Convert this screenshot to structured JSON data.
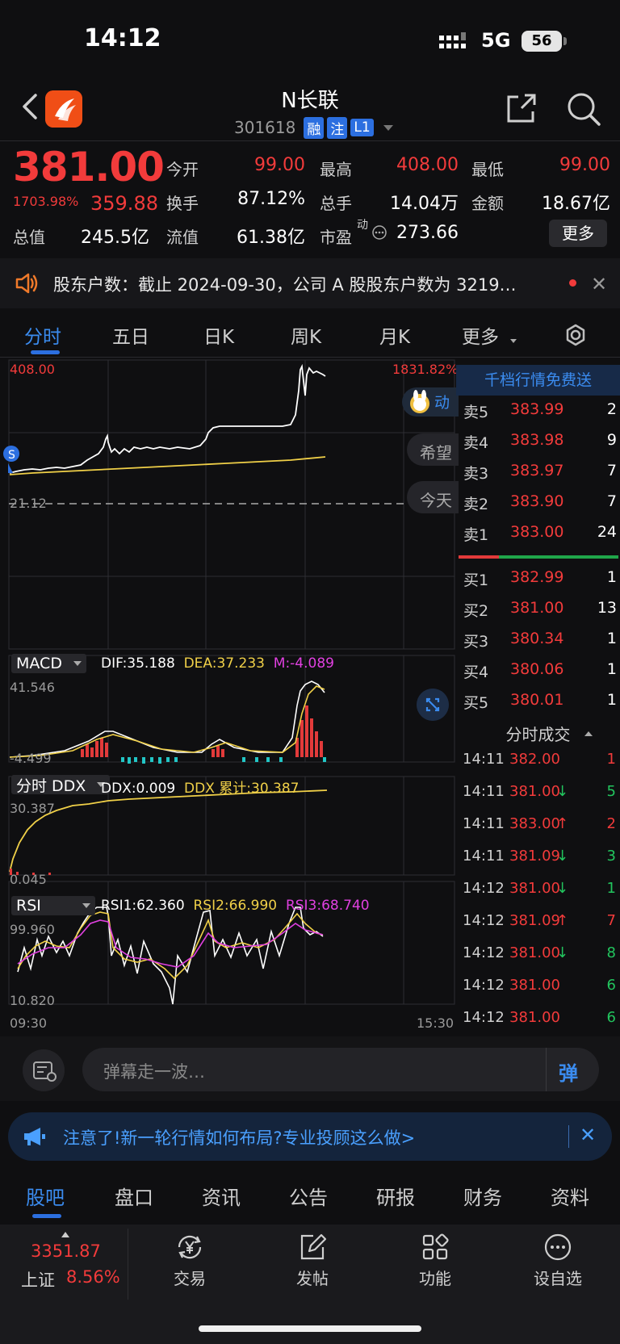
{
  "status": {
    "time": "14:12",
    "network": "5G",
    "battery": "56"
  },
  "header": {
    "stock_name": "N长联",
    "stock_code": "301618",
    "tags": [
      "融",
      "注",
      "L1"
    ]
  },
  "quote": {
    "price": "381.00",
    "change_pct": "1703.98%",
    "change": "359.88",
    "fields": [
      {
        "label": "今开",
        "value": "99.00",
        "color": "#f23b3b"
      },
      {
        "label": "最高",
        "value": "408.00",
        "color": "#f23b3b"
      },
      {
        "label": "最低",
        "value": "99.00",
        "color": "#f23b3b"
      },
      {
        "label": "换手",
        "value": "87.12%",
        "color": "#ffffff"
      },
      {
        "label": "总手",
        "value": "14.04万",
        "color": "#ffffff"
      },
      {
        "label": "金额",
        "value": "18.67亿",
        "color": "#ffffff"
      },
      {
        "label": "流值",
        "value": "61.38亿",
        "color": "#ffffff"
      },
      {
        "label": "市盈",
        "value": "273.66",
        "color": "#ffffff"
      }
    ],
    "total_cap_label": "总值",
    "total_cap_value": "245.5亿",
    "pe_superscript": "动",
    "more_label": "更多"
  },
  "notice": {
    "text": "股东户数：截止 2024-09-30，公司 A 股股东户数为 3219…",
    "close": "✕"
  },
  "chart_tabs": [
    "分时",
    "五日",
    "日K",
    "周K",
    "月K",
    "更多"
  ],
  "chart": {
    "high_label": "408.00",
    "high_pct": "1831.82%",
    "base_label": "21.12",
    "macd": {
      "selector": "MACD",
      "dif": "DIF:35.188",
      "dea": "DEA:37.233",
      "m": "M:-4.089",
      "max": "41.546",
      "min": "-4.499"
    },
    "ddx": {
      "selector": "分时 DDX",
      "ddx": "DDX:0.009",
      "ddx_cum": "DDX 累计:30.387",
      "max": "30.387",
      "min": "0.045"
    },
    "rsi": {
      "selector": "RSI",
      "rsi1": "RSI1:62.360",
      "rsi2": "RSI2:66.990",
      "rsi3": "RSI3:68.740",
      "max": "99.960",
      "min": "10.820"
    },
    "time_start": "09:30",
    "time_end": "15:30",
    "s_marker": "S",
    "chip_dong": "动",
    "chip_xiwang": "希望",
    "chip_jintian": "今天"
  },
  "orderbook": {
    "header": "千档行情免费送",
    "asks": [
      {
        "label": "卖5",
        "price": "383.99",
        "vol": "2"
      },
      {
        "label": "卖4",
        "price": "383.98",
        "vol": "9"
      },
      {
        "label": "卖3",
        "price": "383.97",
        "vol": "7"
      },
      {
        "label": "卖2",
        "price": "383.90",
        "vol": "7"
      },
      {
        "label": "卖1",
        "price": "383.00",
        "vol": "24"
      }
    ],
    "bids": [
      {
        "label": "买1",
        "price": "382.99",
        "vol": "1"
      },
      {
        "label": "买2",
        "price": "381.00",
        "vol": "13"
      },
      {
        "label": "买3",
        "price": "380.34",
        "vol": "1"
      },
      {
        "label": "买4",
        "price": "380.06",
        "vol": "1"
      },
      {
        "label": "买5",
        "price": "380.01",
        "vol": "1"
      }
    ],
    "trades_title": "分时成交",
    "trades": [
      {
        "time": "14:11",
        "price": "382.00",
        "arrow": "",
        "vol": "1",
        "vcolor": "#f23b3b"
      },
      {
        "time": "14:11",
        "price": "381.00",
        "arrow": "↓",
        "vol": "5",
        "vcolor": "#22c55e"
      },
      {
        "time": "14:11",
        "price": "383.00",
        "arrow": "↑",
        "vol": "2",
        "vcolor": "#f23b3b"
      },
      {
        "time": "14:11",
        "price": "381.09",
        "arrow": "↓",
        "vol": "3",
        "vcolor": "#22c55e"
      },
      {
        "time": "14:12",
        "price": "381.00",
        "arrow": "↓",
        "vol": "1",
        "vcolor": "#22c55e"
      },
      {
        "time": "14:12",
        "price": "381.09",
        "arrow": "↑",
        "vol": "7",
        "vcolor": "#f23b3b"
      },
      {
        "time": "14:12",
        "price": "381.00",
        "arrow": "↓",
        "vol": "8",
        "vcolor": "#22c55e"
      },
      {
        "time": "14:12",
        "price": "381.00",
        "arrow": "",
        "vol": "6",
        "vcolor": "#22c55e"
      },
      {
        "time": "14:12",
        "price": "381.00",
        "arrow": "",
        "vol": "6",
        "vcolor": "#22c55e"
      }
    ]
  },
  "danmaku": {
    "placeholder": "弹幕走一波…",
    "send": "弹"
  },
  "ad": {
    "text": "注意了!新一轮行情如何布局?专业投顾这么做>",
    "close": "✕"
  },
  "bottom_tabs": [
    "股吧",
    "盘口",
    "资讯",
    "公告",
    "研报",
    "财务",
    "资料"
  ],
  "bottom_nav": {
    "index_value": "3351.87",
    "index_name": "上证",
    "index_pct": "8.56%",
    "items": [
      {
        "label": "交易",
        "icon": "yen-cycle-icon"
      },
      {
        "label": "发帖",
        "icon": "edit-icon"
      },
      {
        "label": "功能",
        "icon": "grid-icon"
      },
      {
        "label": "设自选",
        "icon": "more-dots-icon"
      }
    ]
  },
  "colors": {
    "up": "#f23b3b",
    "down": "#22c55e",
    "accent": "#2c6fe0",
    "avg_line": "#f0d048"
  }
}
